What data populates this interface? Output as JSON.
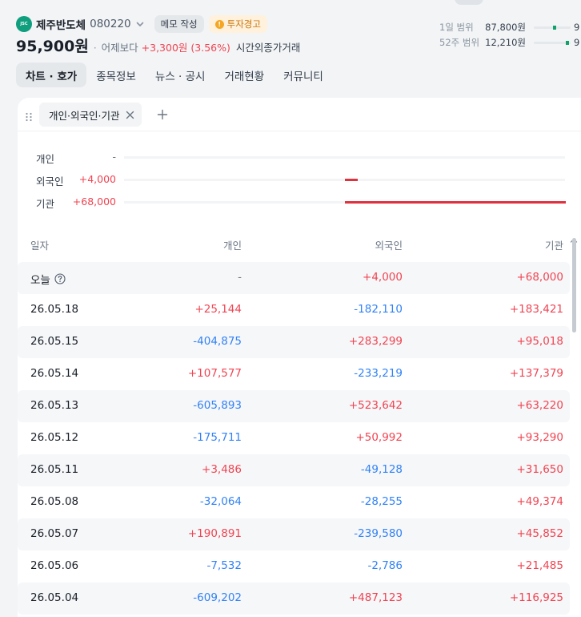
{
  "header": {
    "logo_text": "JSC",
    "stock_name": "제주반도체",
    "stock_code": "080220",
    "memo_label": "메모 작성",
    "warning_label": "투자경고",
    "warning_glyph": "!",
    "price": "95,900원",
    "separator": "·",
    "vs_label": "어제보다",
    "change": "+3,300원 (3.56%)",
    "session": "시간외종가거래",
    "range_1d": {
      "label": "1일 범위",
      "value": "87,800원",
      "clip": "9"
    },
    "range_52w": {
      "label": "52주 범위",
      "value": "12,210원",
      "clip": "9"
    }
  },
  "tabs": [
    {
      "label": "차트 · 호가",
      "active": true
    },
    {
      "label": "종목정보",
      "active": false
    },
    {
      "label": "뉴스 · 공시",
      "active": false
    },
    {
      "label": "거래현황",
      "active": false
    },
    {
      "label": "커뮤니티",
      "active": false
    }
  ],
  "filter": {
    "chip_label": "개인·외국인·기관"
  },
  "summary": [
    {
      "label": "개인",
      "value": "-",
      "tone": "nil",
      "fill_start": 0,
      "fill_ratio": 0
    },
    {
      "label": "외국인",
      "value": "+4,000",
      "tone": "pos",
      "fill_start": 0.5,
      "fill_ratio": 0.029
    },
    {
      "label": "기관",
      "value": "+68,000",
      "tone": "pos",
      "fill_start": 0.5,
      "fill_ratio": 0.5
    }
  ],
  "table": {
    "columns": [
      "일자",
      "개인",
      "외국인",
      "기관"
    ],
    "rows": [
      {
        "date": "오늘",
        "help": true,
        "individual": "-",
        "foreign": "+4,000",
        "institution": "+68,000"
      },
      {
        "date": "26.05.18",
        "individual": "+25,144",
        "foreign": "-182,110",
        "institution": "+183,421"
      },
      {
        "date": "26.05.15",
        "individual": "-404,875",
        "foreign": "+283,299",
        "institution": "+95,018"
      },
      {
        "date": "26.05.14",
        "individual": "+107,577",
        "foreign": "-233,219",
        "institution": "+137,379"
      },
      {
        "date": "26.05.13",
        "individual": "-605,893",
        "foreign": "+523,642",
        "institution": "+63,220"
      },
      {
        "date": "26.05.12",
        "individual": "-175,711",
        "foreign": "+50,992",
        "institution": "+93,290"
      },
      {
        "date": "26.05.11",
        "individual": "+3,486",
        "foreign": "-49,128",
        "institution": "+31,650"
      },
      {
        "date": "26.05.08",
        "individual": "-32,064",
        "foreign": "-28,255",
        "institution": "+49,374"
      },
      {
        "date": "26.05.07",
        "individual": "+190,891",
        "foreign": "-239,580",
        "institution": "+45,852"
      },
      {
        "date": "26.05.06",
        "individual": "-7,532",
        "foreign": "-2,786",
        "institution": "+21,485"
      },
      {
        "date": "26.05.04",
        "individual": "-609,202",
        "foreign": "+487,123",
        "institution": "+116,925"
      }
    ]
  },
  "colors": {
    "positive": "#f04452",
    "negative": "#3182f6",
    "neutral": "#6b7684",
    "bar": "#e0313f",
    "accent_green": "#0fa36b"
  }
}
